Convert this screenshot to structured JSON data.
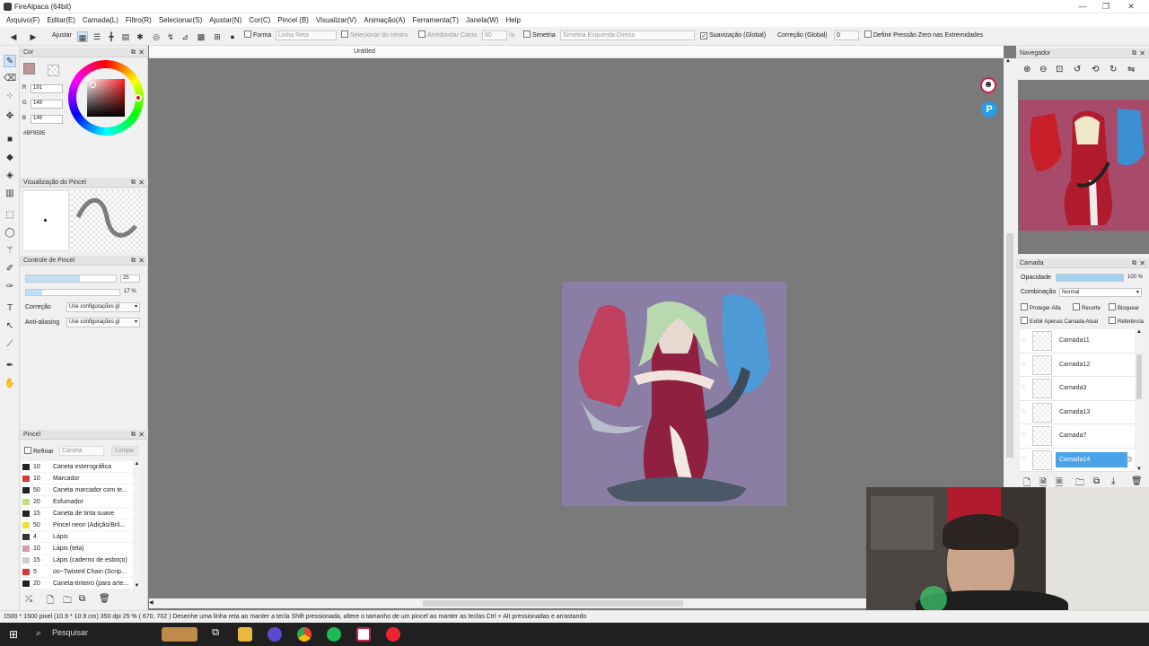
{
  "app": {
    "title": "FireAlpaca (64bit)"
  },
  "menu": [
    "Arquivo(F)",
    "Editar(E)",
    "Camada(L)",
    "Filtro(R)",
    "Selecionar(S)",
    "Ajustar(N)",
    "Cor(C)",
    "Pincel (B)",
    "Visualizar(V)",
    "Animação(A)",
    "Ferramenta(T)",
    "Janela(W)",
    "Help"
  ],
  "toolbar": {
    "ajustar": "Ajustar",
    "forma": "Forma",
    "linha_reta": "Linha Reta",
    "selecionar_centro": "Selecionar do centro",
    "arredondar": "Arredondar Canto",
    "arredondar_val": "80",
    "pct": "%",
    "simetria": "Simetria",
    "simetria_mode": "Simetria Esquerda-Direita",
    "suavizacao": "Suavização (Global)",
    "correcao": "Correção (Global)",
    "correcao_val": "0",
    "pressao": "Definir Pressão Zero nas Extremidades"
  },
  "color_panel": {
    "title": "Cor",
    "r_label": "R",
    "g_label": "G",
    "b_label": "B",
    "r": "191",
    "g": "149",
    "b": "149",
    "hex": "#BF9595"
  },
  "brush_preview": {
    "title": "Visualização do Pincel"
  },
  "brush_control": {
    "title": "Controle de Pincel",
    "size": "25",
    "opacity": "17 %",
    "size_fill": 0.6,
    "opacity_fill": 0.17,
    "correcao_label": "Correção",
    "correcao_val": "Use configurações gl",
    "aa_label": "Anti-aliasing",
    "aa_val": "Use configurações gl"
  },
  "brush_panel": {
    "title": "Pincel",
    "refinar": "Refinar",
    "caneta": "Caneta",
    "limpar": "Limpar",
    "items": [
      {
        "size": "10",
        "name": "Caneta esterográfica",
        "color": "#222222"
      },
      {
        "size": "10",
        "name": "Marcador",
        "color": "#d63a3a"
      },
      {
        "size": "50",
        "name": "Caneta marcador com te...",
        "color": "#222222"
      },
      {
        "size": "20",
        "name": "Esfumador",
        "color": "#bde07a"
      },
      {
        "size": "15",
        "name": "Caneta de tinta suave",
        "color": "#222222"
      },
      {
        "size": "50",
        "name": "Pincel neon (Adição/Bril...",
        "color": "#e8e23a"
      },
      {
        "size": "4",
        "name": "Lápis",
        "color": "#333333"
      },
      {
        "size": "10",
        "name": "Lápis (tela)",
        "color": "#d89aa8"
      },
      {
        "size": "15",
        "name": "Lápis (caderno de esboço)",
        "color": "#cfcfcf"
      },
      {
        "size": "5",
        "name": "oo~Twisted Chain (Scrip...",
        "color": "#d63a3a"
      },
      {
        "size": "20",
        "name": "Caneta-tinteiro (para arte...",
        "color": "#222222"
      }
    ]
  },
  "document": {
    "tab": "Untitled"
  },
  "navigator": {
    "title": "Navegador"
  },
  "layer_panel": {
    "title": "Camada",
    "opacity_label": "Opacidade",
    "opacity": "100 %",
    "opacity_fill": 1.0,
    "blend_label": "Combinação",
    "blend": "Normal",
    "protect": "Proteger Alfa",
    "clip": "Recorte",
    "lock": "Bloquear",
    "show_only": "Exibir Apenas Camada Atual",
    "ref": "Referência",
    "layers": [
      "Camada11",
      "Camada12",
      "Camada3",
      "Camada13",
      "Camada7",
      "Camada14"
    ]
  },
  "status": {
    "text": "1500 * 1500 pixel  (10.9 * 10.9 cm)  350 dpi  25 %  ( 670, 702 )  Desenhe uma linha reta ao manter a tecla Shift pressionada, altere o tamanho de um pincel ao manter as teclas Ctrl + Alt pressionadas e arrastando"
  },
  "taskbar": {
    "search": "Pesquisar"
  },
  "colors": {
    "fg": "#BF9595",
    "accent": "#8ec9ef",
    "canvas_bg": "#8a7ea4"
  }
}
